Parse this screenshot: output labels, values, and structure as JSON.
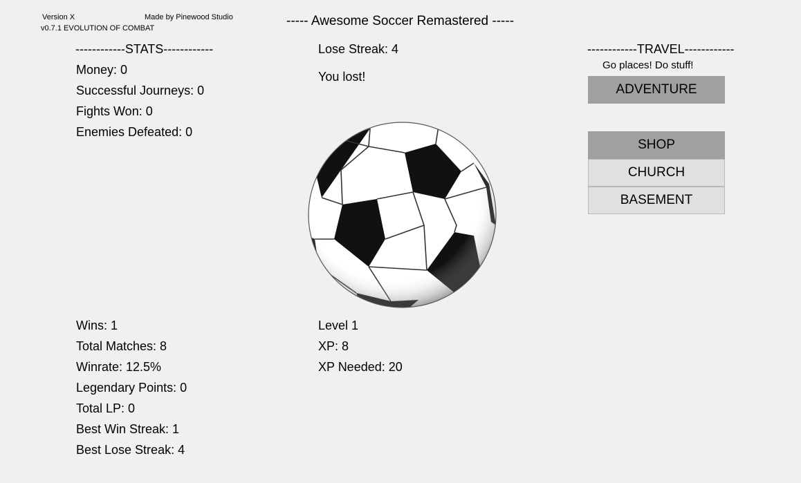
{
  "header": {
    "version": "Version X",
    "credits": "Made by Pinewood Studio",
    "subtitle": "v0.7.1 EVOLUTION OF COMBAT",
    "title": "----- Awesome Soccer Remastered -----"
  },
  "stats": {
    "heading": "------------STATS------------",
    "money": "Money: 0",
    "journeys": "Successful Journeys: 0",
    "fights_won": "Fights Won: 0",
    "enemies_defeated": "Enemies Defeated: 0"
  },
  "status": {
    "lose_streak": "Lose Streak: 4",
    "message": "You lost!"
  },
  "ball": {
    "icon": "soccer-ball-icon"
  },
  "travel": {
    "heading": "------------TRAVEL------------",
    "subtitle": "Go places! Do stuff!",
    "adventure": "ADVENTURE",
    "shop": "SHOP",
    "church": "CHURCH",
    "basement": "BASEMENT"
  },
  "record": {
    "wins": "Wins: 1",
    "total_matches": "Total Matches: 8",
    "winrate": "Winrate: 12.5%",
    "legendary_points": "Legendary Points: 0",
    "total_lp": "Total LP: 0",
    "best_win_streak": "Best Win Streak: 1",
    "best_lose_streak": "Best Lose Streak: 4"
  },
  "level": {
    "level": "Level 1",
    "xp": "XP: 8",
    "xp_needed": "XP Needed: 20"
  },
  "colors": {
    "background": "#f0f0f0",
    "button_dark": "#a0a0a0",
    "button_light": "#e0e0e0"
  }
}
